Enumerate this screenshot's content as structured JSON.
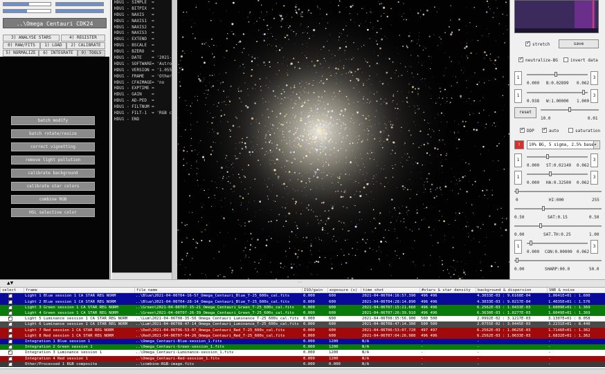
{
  "app": {
    "object_title": "..\\Omega Centauri CDK24"
  },
  "progress": [
    {
      "value": 0.55
    },
    {
      "value": 1.0
    },
    {
      "value": 0.5
    },
    {
      "value": 1.0
    }
  ],
  "tabs": [
    {
      "label": "3) ANALYSE STARS"
    },
    {
      "label": "4) REGISTER"
    },
    {
      "label": "0) RAW/FITS"
    },
    {
      "label": "1) LOAD"
    },
    {
      "label": "2) CALIBRATE"
    },
    {
      "label": "5) NORMALIZE"
    },
    {
      "label": "6) INTEGRATE"
    },
    {
      "label": "9) TOOLS"
    }
  ],
  "tools": [
    {
      "label": "batch modify"
    },
    {
      "label": "batch rotate/resize"
    },
    {
      "label": "correct vignetting"
    },
    {
      "label": "remove light pollution"
    },
    {
      "label": "calibrate background"
    },
    {
      "label": "calibrate star colors"
    },
    {
      "label": "combine RGB"
    },
    {
      "label": "HSL selective color"
    }
  ],
  "header_lines": [
    "HDU1 - SIMPLE  =",
    "HDU1 - BITPIX  =",
    "HDU1 - NAXIS   =",
    "HDU1 - NAXIS1  =",
    "HDU1 - NAXIS2  =",
    "HDU1 - NAXIS3  =",
    "HDU1 - EXTEND  =",
    "HDU1 - BSCALE  =",
    "HDU1 - BZERO   =",
    "HDU1 - DATE    = '2021-",
    "HDU1 - SOFTWARE= 'Astro",
    "HDU1 - VERSION = '1.055",
    "HDU1 - FRAME   = 'Other",
    "HDU1 - CFAIMAGE= 'no",
    "HDU1 - EXPTIME =",
    "HDU1 - GAIN    =",
    "HDU1 - AD-PED  =",
    "HDU1 - FILTNUM =",
    "HDU1 - FILT-1  = 'RGB c",
    "HDU1 - END"
  ],
  "right": {
    "stretch_label": "stretch",
    "save_label": "save",
    "neutralize_label": "neutralize-BG",
    "invert_label": "invert data",
    "b_low": "0.000",
    "b_label": "B:0.02899",
    "b_high": "0.062",
    "w_low": "0.938",
    "w_label": "W:1.00000",
    "w_high": "1.000",
    "reset_label": "reset",
    "gamma_low": "10.0",
    "gamma_high": "0.01",
    "ddp_label": "DDP",
    "auto_label": "auto",
    "saturation_label": "saturation",
    "bg_option": "10% BG, 5 sigma, 2.5% base",
    "st_low": "0.000",
    "st_label": "ST:0.02149",
    "st_high": "0.062",
    "ha_low": "0.000",
    "ha_label": "HA:0.32500",
    "ha_high": "0.062",
    "hi_low": "0",
    "hi_label": "HI:000",
    "hi_high": "255",
    "sat_low": "0.50",
    "sat_label": "SAT:0.15",
    "sat_high": "0.50",
    "satth_low": "0.00",
    "satth_label": "SAT.TH:0.25",
    "satth_high": "1.00",
    "con_low": "0.000",
    "con_label": "CON:0.00000",
    "con_high": "0.062",
    "sharp_low": "0.00",
    "sharp_label": "SHARP:00.0",
    "sharp_high": "50.0",
    "btn_1": "1",
    "btn_3": "3",
    "accent": "#d43030"
  },
  "table": {
    "headers": [
      "select",
      "frame",
      "file name",
      "ISO/gain",
      "exposure (s)",
      "time shot",
      "#stars & star density",
      "background & dispersion",
      "SNR & noise"
    ],
    "rows": [
      {
        "frame": "Light 1 Blue session 1  CA STAR REG NORM",
        "file": "..\\Blue\\2021-04-06T04-16-57_Omega_Centauri_Blue_T-25_600s_cal.fits",
        "iso": "0.000",
        "exp": "600",
        "time": "2021-04-06T04:16:57.390",
        "stars": "496 496",
        "bg": "4.3033E-03 : 9.6168E-04",
        "snr": "1.0641E+01 : 1.600",
        "bgc": "#0a0a9a",
        "fg": "#ffffff"
      },
      {
        "frame": "Light 2 Blue session 1  CA STAR REG NORM",
        "file": "..\\Blue\\2021-04-06T04-28-14_Omega_Centauri_Blue_T-25_600s_cal.fits",
        "iso": "0.000",
        "exp": "600",
        "time": "2021-04-06T04:28:14.890",
        "stars": "496 496",
        "bg": "4.3033E-03 : 9.0217E-04",
        "snr": "1.4035E+01 : 1.576",
        "bgc": "#0a0a9a",
        "fg": "#ffffff"
      },
      {
        "frame": "Light 3 Green session 1  CA STAR REG NORM",
        "file": "..\\Green\\2021-04-06T07-15-21_Omega_Centauri_Green_T-25_600s_cal.fits",
        "iso": "0.000",
        "exp": "600",
        "time": "2021-04-06T07:15:21.660",
        "stars": "496 496",
        "bg": "6.2562E-03 : 1.0433E-03",
        "snr": "1.6009E+01 : 1.369",
        "bgc": "#0a7a0a",
        "fg": "#ffffff"
      },
      {
        "frame": "Light 4 Green session 1  CA STAR REG NORM",
        "file": "..\\Green\\2021-04-06T07-26-39_Omega_Centauri_Green_T-25_600s_cal.fits",
        "iso": "0.000",
        "exp": "600",
        "time": "2021-04-06T07:26:39.910",
        "stars": "496 496",
        "bg": "6.3630E-03 : 1.0277E-03",
        "snr": "1.6049E+01 : 1.369",
        "bgc": "#0a7a0a",
        "fg": "#ffffff"
      },
      {
        "frame": "Light 5 Luminance session 1  CA STAR REG NORM",
        "file": "..\\Lum\\2021-04-06T08-35-56_Omega_Centauri_Luminance_T-25_600s_cal.fits",
        "iso": "0.000",
        "exp": "600",
        "time": "2021-04-06T08:35:56.900",
        "stars": "500 500",
        "bg": "2.0992E-02 : 3.1217E-03",
        "snr": "3.1307E+01 : 8.058",
        "bgc": "#ffffff",
        "fg": "#111111"
      },
      {
        "frame": "Light 6 Luminance session 1  CA STAR REG NORM",
        "file": "..\\Lum\\2021-04-06T08-47-14_Omega_Centauri_Luminance_T-25_600s_cal.fits",
        "iso": "0.000",
        "exp": "600",
        "time": "2021-04-06T08:47:14.300",
        "stars": "500 500",
        "bg": "2.0755E-02 : 3.0445E-03",
        "snr": "3.2231E+01 : 8.440",
        "bgc": "#4a4a4a",
        "fg": "#ffffff"
      },
      {
        "frame": "Light 7 Red session 1  CA STAR REG NORM",
        "file": "..\\Red\\2021-04-06T06-53-07_Omega_Centauri_Red_T-25_600s_cal.fits",
        "iso": "0.000",
        "exp": "600",
        "time": "2021-04-06T06:53:07.720",
        "stars": "497 497",
        "bg": "6.2562E-03 : 1.0625E-03",
        "snr": "1.7146E+01 : 1.362",
        "bgc": "#a00a0a",
        "fg": "#ffffff"
      },
      {
        "frame": "Light 8 Red session 1  CA STAR REG NORM",
        "file": "..\\Red\\2021-04-06T07-04-26_Omega_Centauri_Red_T-25_600s_cal.fits",
        "iso": "0.000",
        "exp": "600",
        "time": "2021-04-06T07:04:26.980",
        "stars": "496 496",
        "bg": "6.2562E-03 : 1.0633E-03",
        "snr": "1.6832E+01 : 1.362",
        "bgc": "#a00a0a",
        "fg": "#ffffff"
      },
      {
        "frame": "Integration 1 Blue session 1",
        "file": "..\\Omega_Centauri-Blue-session_1.fits",
        "iso": "0.000",
        "exp": "1200",
        "time": "N/A",
        "stars": "-",
        "bg": "-",
        "snr": "-",
        "bgc": "#0a0a9a",
        "fg": "#ffffff"
      },
      {
        "frame": "Integration 2 Green session 1",
        "file": "..\\Omega_Centauri-Green-session_1.fits",
        "iso": "0.000",
        "exp": "1200",
        "time": "N/A",
        "stars": "-",
        "bg": "-",
        "snr": "-",
        "bgc": "#0a7a0a",
        "fg": "#ffffff"
      },
      {
        "frame": "Integration 3 Luminance session 1",
        "file": "..\\Omega_Centauri-Luminance-session_1.fits",
        "iso": "0.000",
        "exp": "1200",
        "time": "N/A",
        "stars": "-",
        "bg": "-",
        "snr": "-",
        "bgc": "#ffffff",
        "fg": "#111111"
      },
      {
        "frame": "Integration 4 Red session 1",
        "file": "..\\Omega_Centauri-Red-session_1.fits",
        "iso": "0.000",
        "exp": "1200",
        "time": "N/A",
        "stars": "-",
        "bg": "-",
        "snr": "-",
        "bgc": "#a00a0a",
        "fg": "#ffffff"
      },
      {
        "frame": "Other/Processed 1 RGB composite",
        "file": "..\\combine-RGB-image.fits",
        "iso": "0.000",
        "exp": "0.000",
        "time": "N/A",
        "stars": "-",
        "bg": "-",
        "snr": "-",
        "bgc": "#3a3a3a",
        "fg": "#ffffff"
      }
    ]
  }
}
